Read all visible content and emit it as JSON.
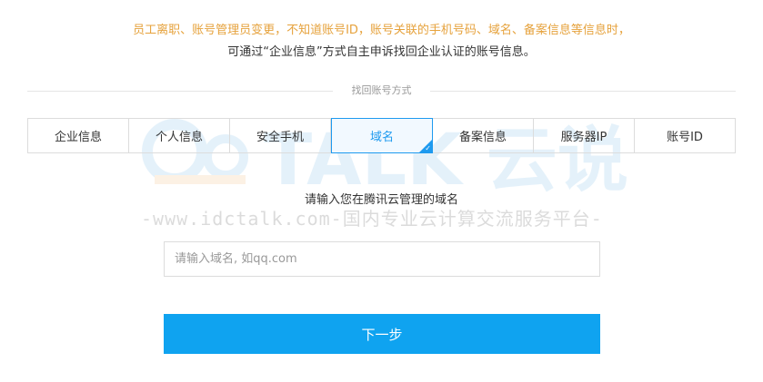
{
  "notice": {
    "line1": "员工离职、账号管理员变更，不知道账号ID，账号关联的手机号码、域名、备案信息等信息时，",
    "line2": "可通过“企业信息”方式自主申诉找回企业认证的账号信息。"
  },
  "section_label": "找回账号方式",
  "tabs": [
    {
      "label": "企业信息"
    },
    {
      "label": "个人信息"
    },
    {
      "label": "安全手机"
    },
    {
      "label": "域名"
    },
    {
      "label": "备案信息"
    },
    {
      "label": "服务器IP"
    },
    {
      "label": "账号ID"
    }
  ],
  "active_tab": "域名",
  "watermark": {
    "brand": "TALK 云说",
    "subtitle": "-www.idctalk.com-国内专业云计算交流服务平台-"
  },
  "form": {
    "prompt": "请输入您在腾讯云管理的域名",
    "placeholder": "请输入域名, 如qq.com",
    "value": "",
    "next_label": "下一步"
  },
  "colors": {
    "accent": "#1e9aef",
    "button": "#0fa3f0",
    "warning_text": "#e6a23c"
  }
}
